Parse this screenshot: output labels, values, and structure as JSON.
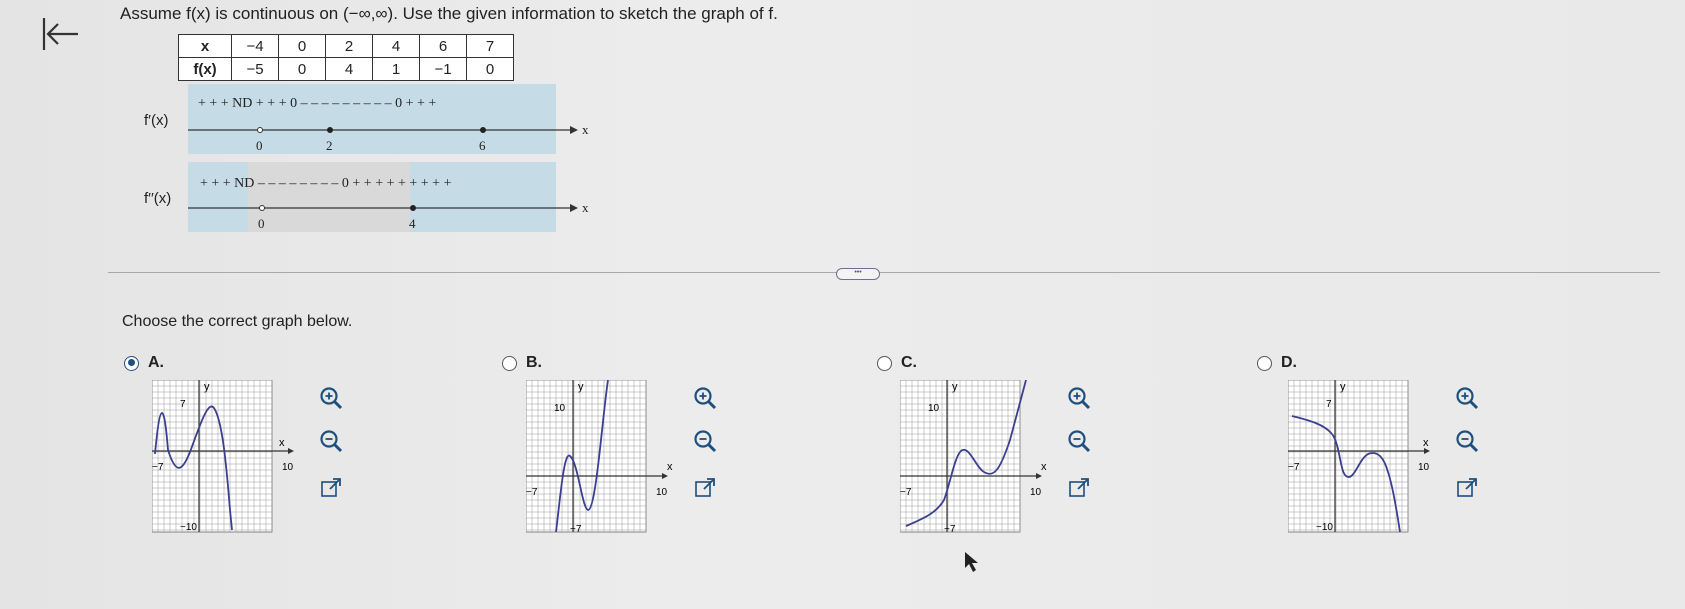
{
  "question": {
    "text": "Assume f(x) is continuous on (−∞,∞). Use the given information to sketch the graph of f."
  },
  "table": {
    "row_x_label": "x",
    "row_f_label": "f(x)",
    "x_values": [
      "−4",
      "0",
      "2",
      "4",
      "6",
      "7"
    ],
    "f_values": [
      "−5",
      "0",
      "4",
      "1",
      "−1",
      "0"
    ]
  },
  "sign_chart": {
    "fprime_label": "f′(x)",
    "fprime_signs": "+ + + ND + + + 0 – – – – – – – – – 0 + + +",
    "fprime_ticks": [
      "0",
      "2",
      "6"
    ],
    "fdouble_label": "f′′(x)",
    "fdouble_signs": "+ + + ND – – – – – – – – 0 + + + + + + + + +",
    "fdouble_ticks": [
      "0",
      "4"
    ],
    "axis_label": "x"
  },
  "choose_text": "Choose the correct graph below.",
  "options": [
    {
      "letter": "A.",
      "selected": true,
      "graph": {
        "y_label": "y",
        "x_label": "x",
        "y_top": "7",
        "y_bottom": "−10",
        "x_left": "−7",
        "x_right": "10"
      }
    },
    {
      "letter": "B.",
      "selected": false,
      "graph": {
        "y_label": "y",
        "x_label": "x",
        "y_top": "10",
        "y_bottom": "−7",
        "x_left": "−7",
        "x_right": "10"
      }
    },
    {
      "letter": "C.",
      "selected": false,
      "graph": {
        "y_label": "y",
        "x_label": "x",
        "y_top": "10",
        "y_bottom": "−7",
        "x_left": "−7",
        "x_right": "10"
      }
    },
    {
      "letter": "D.",
      "selected": false,
      "graph": {
        "y_label": "y",
        "x_label": "x",
        "y_top": "7",
        "y_bottom": "−10",
        "x_left": "−7",
        "x_right": "10"
      }
    }
  ],
  "colors": {
    "accent": "#1d4f7f",
    "curve": "#3b3f8f",
    "chart_band": "#c5dbe6"
  }
}
